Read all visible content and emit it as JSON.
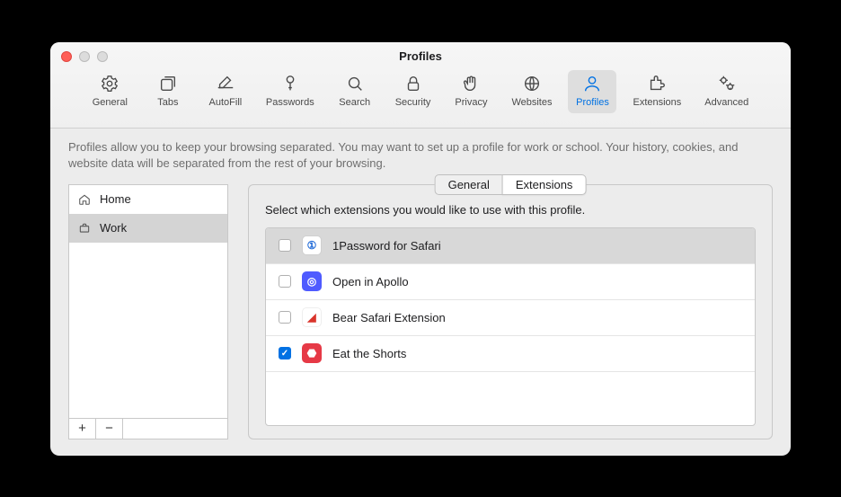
{
  "window_title": "Profiles",
  "toolbar": [
    {
      "id": "general",
      "label": "General"
    },
    {
      "id": "tabs",
      "label": "Tabs"
    },
    {
      "id": "autofill",
      "label": "AutoFill"
    },
    {
      "id": "passwords",
      "label": "Passwords"
    },
    {
      "id": "search",
      "label": "Search"
    },
    {
      "id": "security",
      "label": "Security"
    },
    {
      "id": "privacy",
      "label": "Privacy"
    },
    {
      "id": "websites",
      "label": "Websites"
    },
    {
      "id": "profiles",
      "label": "Profiles",
      "active": true
    },
    {
      "id": "extensions",
      "label": "Extensions"
    },
    {
      "id": "advanced",
      "label": "Advanced"
    }
  ],
  "description": "Profiles allow you to keep your browsing separated. You may want to set up a profile for work or school. Your history, cookies, and website data will be separated from the rest of your browsing.",
  "profiles": [
    {
      "name": "Home",
      "selected": false
    },
    {
      "name": "Work",
      "selected": true
    }
  ],
  "segmented": {
    "general": "General",
    "extensions": "Extensions",
    "active": "extensions"
  },
  "hint": "Select which extensions you would like to use with this profile.",
  "extensions": [
    {
      "name": "1Password for Safari",
      "checked": false,
      "selected": true,
      "icon_bg": "#ffffff",
      "icon_fg": "#1a66d6",
      "glyph": "①"
    },
    {
      "name": "Open in Apollo",
      "checked": false,
      "selected": false,
      "icon_bg": "#4f5bff",
      "icon_fg": "#ffffff",
      "glyph": "▦"
    },
    {
      "name": "Bear Safari Extension",
      "checked": false,
      "selected": false,
      "icon_bg": "#ffffff",
      "icon_fg": "#d9342b",
      "glyph": "◢"
    },
    {
      "name": "Eat the Shorts",
      "checked": true,
      "selected": false,
      "icon_bg": "#e63946",
      "icon_fg": "#ffffff",
      "glyph": "⬣"
    }
  ]
}
